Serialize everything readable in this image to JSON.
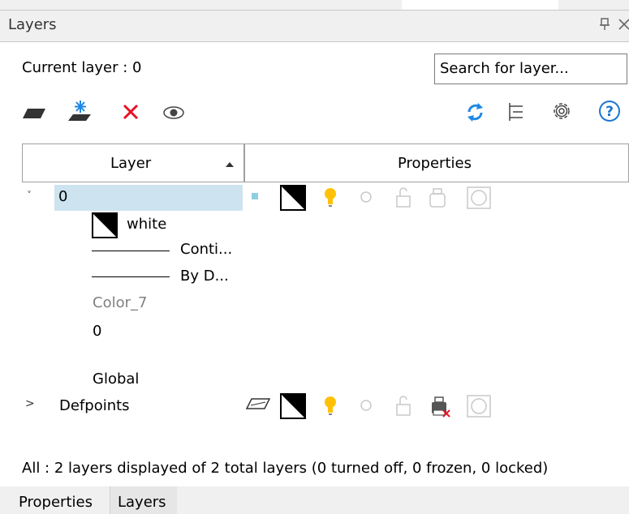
{
  "window": {
    "title": "Layers"
  },
  "current_layer": {
    "text": "Current layer : 0"
  },
  "search": {
    "placeholder": "Search for layer..."
  },
  "toolbar": {
    "icons": [
      "new-layer-icon",
      "new-layer-viewport-icon",
      "delete-layer-icon",
      "visibility-icon",
      "refresh-icon",
      "list-icon",
      "settings-icon",
      "help-icon"
    ],
    "delete_color": "#e81123",
    "refresh_color": "#1e88e5",
    "help_color": "#1976d2",
    "help_label": "?"
  },
  "table": {
    "headers": {
      "layer": "Layer",
      "properties": "Properties"
    },
    "rows": [
      {
        "expand": "˅",
        "name": "0",
        "details": {
          "color": "white",
          "linetype": "Conti...",
          "lineweight": "By D...",
          "plot_style": "Color_7",
          "transparency": "0",
          "viewport": "Global"
        }
      },
      {
        "expand": ">",
        "name": "Defpoints"
      }
    ],
    "selected_color": "#cde3ef",
    "bulb_color": "#ffc107"
  },
  "status": {
    "text": "All : 2 layers displayed of 2 total layers (0 turned off, 0 frozen, 0 locked)"
  },
  "tabs": [
    {
      "label": "Properties"
    },
    {
      "label": "Layers"
    }
  ]
}
